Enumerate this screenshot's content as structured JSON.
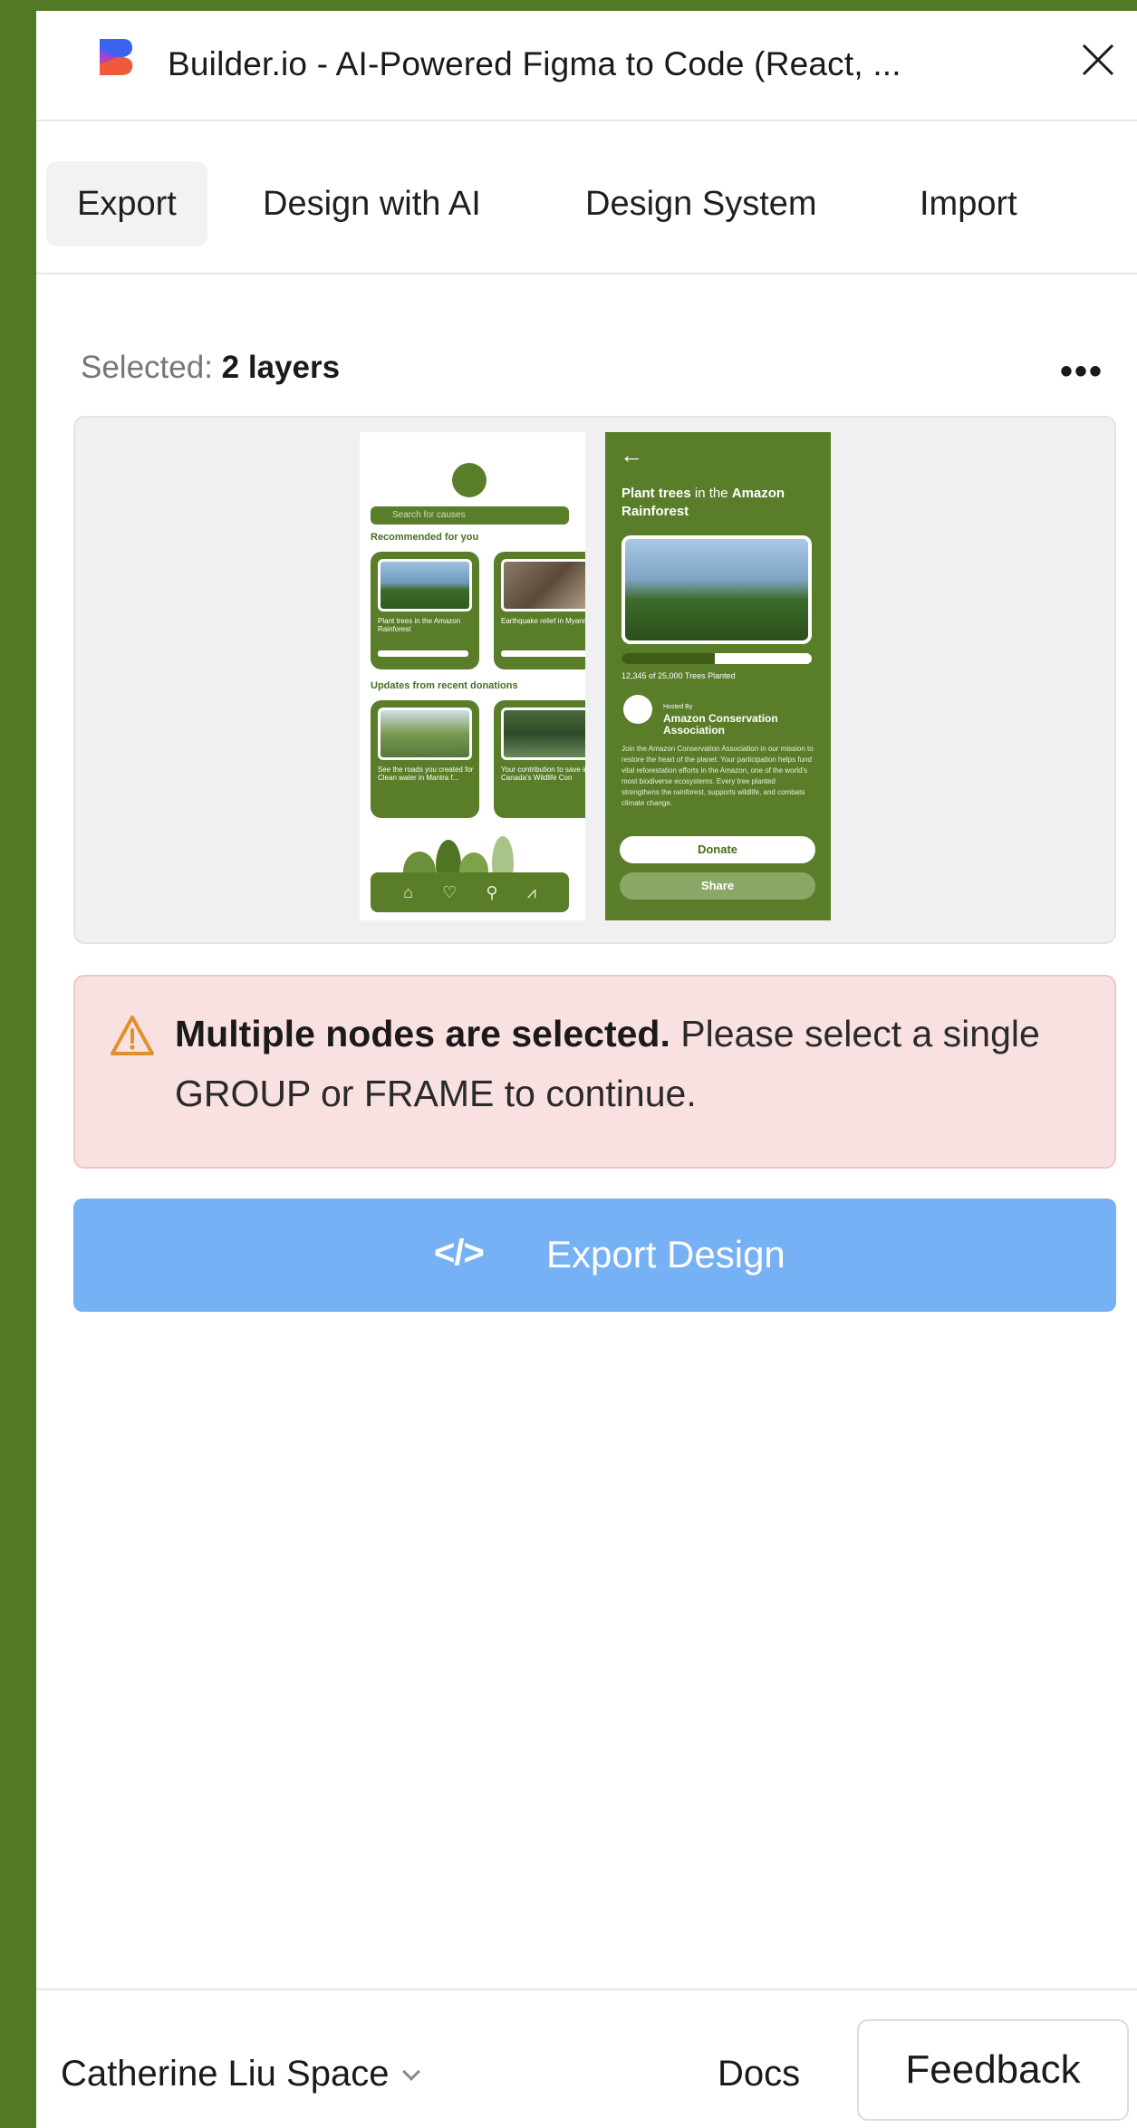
{
  "window": {
    "title": "Builder.io - AI-Powered Figma to Code (React, ...",
    "brand_colors": {
      "logo_top": "#3b63f0",
      "logo_bottom": "#f05a3b",
      "accent": "#76b1f5"
    }
  },
  "tabs": [
    {
      "label": "Export",
      "active": true
    },
    {
      "label": "Design with AI",
      "active": false
    },
    {
      "label": "Design System",
      "active": false
    },
    {
      "label": "Import",
      "active": false
    }
  ],
  "selection": {
    "prefix": "Selected:",
    "value": "2 layers",
    "more_label": "•••"
  },
  "preview": {
    "phone1": {
      "search_placeholder": "Search for causes",
      "heading_recommended": "Recommended for you",
      "card1_text": "Plant trees in the Amazon Rainforest",
      "card2_text": "Earthquake relief in Myanmar",
      "heading_updates": "Updates from recent donations",
      "card3_text": "See the roads you created for Clean water in Mantra f...",
      "card4_text": "Your contribution to save in Canada's Wildlife Con"
    },
    "phone2": {
      "back": "←",
      "title_strong": "Plant trees",
      "title_mid": " in the ",
      "title_strong2": "Amazon Rainforest",
      "progress_fraction": 0.49,
      "count": "12,345 of 25,000 Trees Planted",
      "hosted_by": "Hosted By",
      "association": "Amazon Conservation Association",
      "body": "Join the Amazon Conservation Association in our mission to restore the heart of the planet. Your participation helps fund vital reforestation efforts in the Amazon, one of the world's most biodiverse ecosystems. Every tree planted strengthens the rainforest, supports wildlife, and combats climate change.",
      "donate": "Donate",
      "share": "Share"
    }
  },
  "alert": {
    "strong": "Multiple nodes are selected.",
    "rest": " Please select a single GROUP or FRAME to continue.",
    "icon": "warning-icon"
  },
  "export_button": {
    "icon": "</>",
    "label": "Export Design"
  },
  "footer": {
    "space": "Catherine Liu Space",
    "docs": "Docs",
    "feedback": "Feedback"
  }
}
